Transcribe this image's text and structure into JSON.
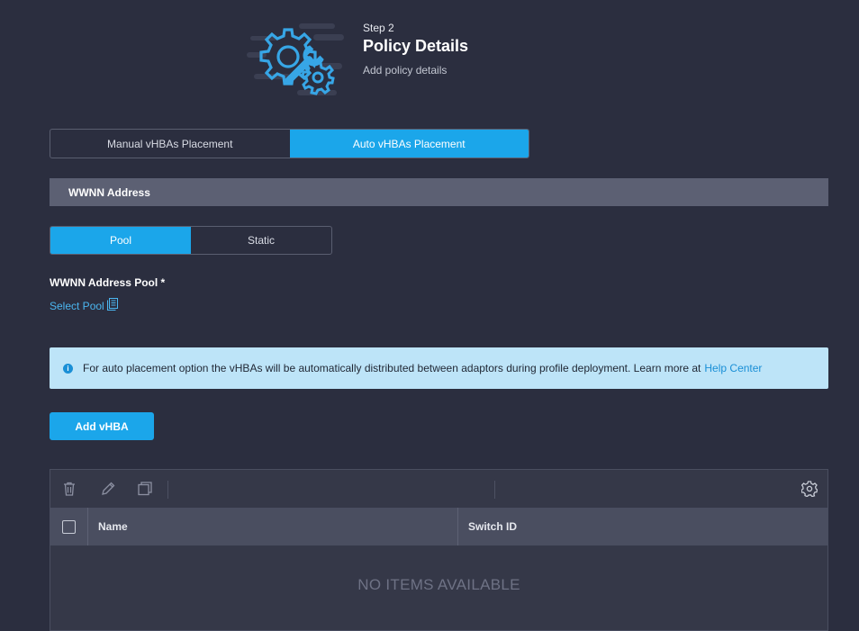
{
  "header": {
    "step_label": "Step 2",
    "title": "Policy Details",
    "subtitle": "Add policy details"
  },
  "placement_toggle": {
    "options": [
      "Manual vHBAs Placement",
      "Auto vHBAs Placement"
    ],
    "selected": "Auto vHBAs Placement"
  },
  "wwnn_section": {
    "title": "WWNN Address",
    "type_toggle": {
      "options": [
        "Pool",
        "Static"
      ],
      "selected": "Pool"
    },
    "pool_label": "WWNN Address Pool *",
    "select_pool_link": "Select Pool"
  },
  "info_banner": {
    "text": "For auto placement option the vHBAs will be automatically distributed between adaptors during profile deployment. Learn more at",
    "link": "Help Center"
  },
  "add_button": "Add vHBA",
  "table": {
    "columns": [
      "Name",
      "Switch ID"
    ],
    "toolbar_icons": [
      "trash-icon",
      "pencil-icon",
      "clone-icon",
      "gear-icon"
    ],
    "empty_text": "NO ITEMS AVAILABLE"
  },
  "colors": {
    "background": "#2b2e3f",
    "accent": "#1ba6ea",
    "section_bar": "#5c6073",
    "info_bg": "#bde4f8",
    "link": "#4bb6f0"
  }
}
